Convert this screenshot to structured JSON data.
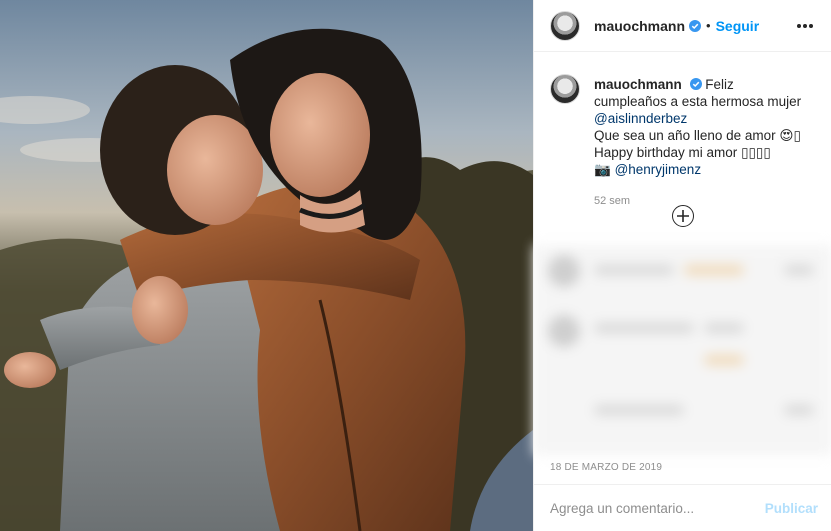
{
  "post": {
    "username": "mauochmann",
    "follow_label": "Seguir",
    "separator": "•",
    "caption": {
      "username": "mauochmann",
      "line1": "Feliz cumpleaños a esta hermosa mujer",
      "mention1": "@aislinnderbez",
      "line2": "Que sea un año lleno de amor",
      "emoji1": "😍",
      "box1": "▯",
      "line3": "Happy birthday mi amor",
      "boxes": "▯▯▯▯",
      "camera": "📷",
      "mention2": "@henryjimenz"
    },
    "time_ago": "52 sem",
    "date": "18 DE MARZO DE 2019",
    "comment": {
      "placeholder": "Agrega un comentario...",
      "post_label": "Publicar"
    }
  },
  "icons": {
    "verified": "verified-badge-icon",
    "more": "more-options-icon",
    "load_more": "plus-circle-icon"
  },
  "colors": {
    "follow": "#0095f6",
    "verified": "#3897f0",
    "mention": "#00376b",
    "post_disabled": "#b2dffc",
    "muted": "#8e8e8e"
  }
}
